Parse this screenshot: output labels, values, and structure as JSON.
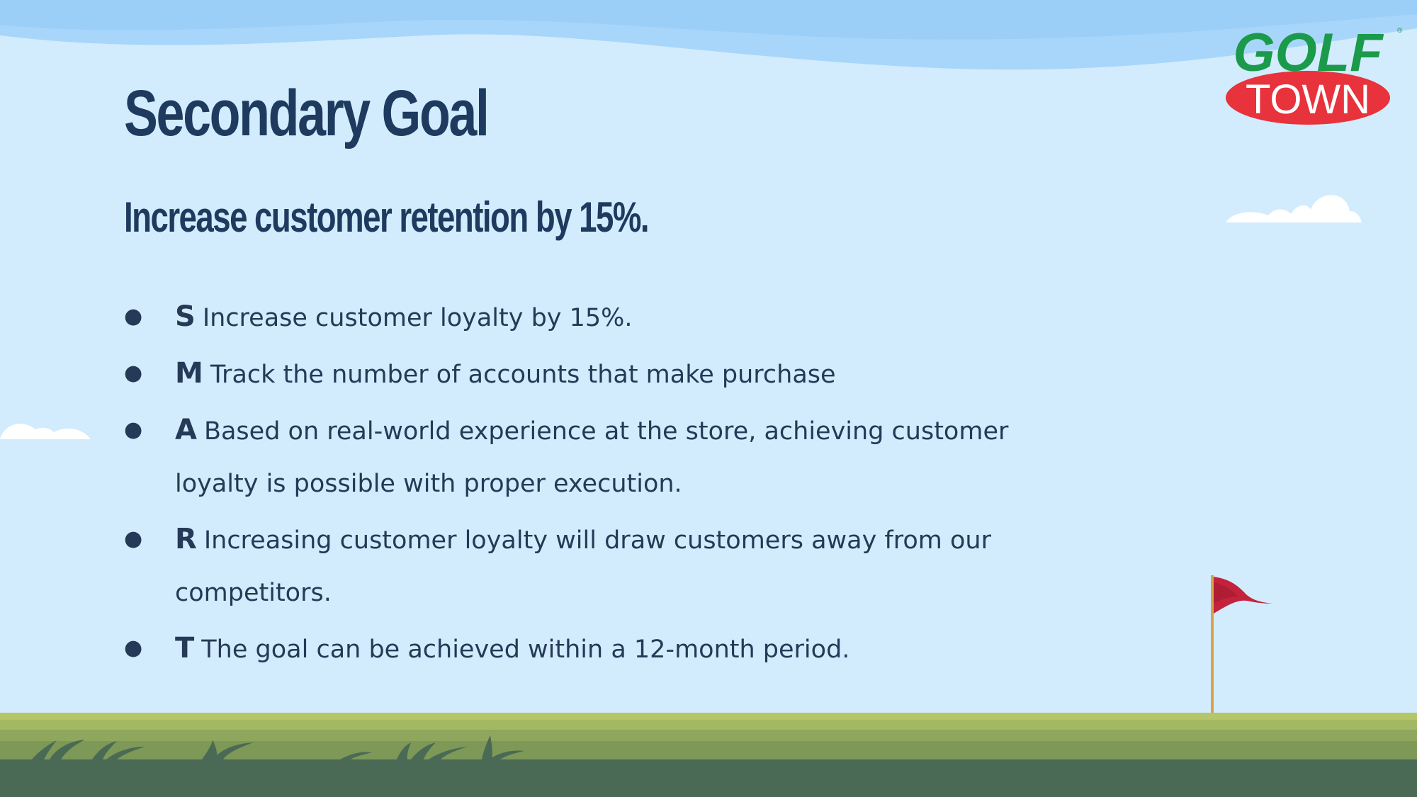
{
  "slide": {
    "title": "Secondary Goal",
    "subtitle": "Increase customer retention by 15%.",
    "goals": [
      {
        "letter": "S",
        "text": "Increase customer loyalty by 15%."
      },
      {
        "letter": "M",
        "text": "Track the number of accounts that make purchase"
      },
      {
        "letter": "A",
        "text": "Based on real-world experience at the store, achieving customer loyalty is possible with proper execution."
      },
      {
        "letter": "R",
        "text": "Increasing customer loyalty will draw customers away from our competitors."
      },
      {
        "letter": "T",
        "text": "The goal can be achieved within a 12-month period."
      }
    ],
    "bullet": "●"
  },
  "logo": {
    "line1": "GOLF",
    "line2": "TOWN",
    "registered": "®",
    "colors": {
      "green": "#1a9a4a",
      "red": "#e8323c"
    }
  },
  "icons": [
    "golf-flag-icon",
    "cloud-icon",
    "grass-icon"
  ],
  "colors": {
    "sky": "#d2ecfd",
    "text": "#1e3a5f",
    "ground_dark": "#4a6a55",
    "ground_light": "#b5c66a"
  }
}
